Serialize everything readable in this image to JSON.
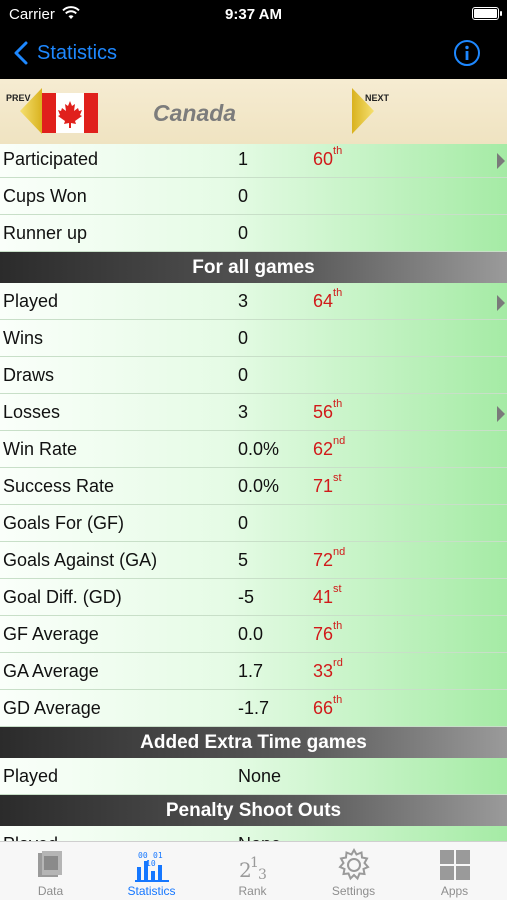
{
  "status_bar": {
    "carrier": "Carrier",
    "time": "9:37 AM"
  },
  "nav": {
    "back_label": "Statistics"
  },
  "team": {
    "name": "Canada",
    "prev_label": "PREV",
    "next_label": "NEXT"
  },
  "rows_top": [
    {
      "label": "Participated",
      "value": "1",
      "rank": "60",
      "suffix": "th",
      "chevron": true
    },
    {
      "label": "Cups Won",
      "value": "0",
      "rank": "",
      "suffix": "",
      "chevron": false
    },
    {
      "label": "Runner up",
      "value": "0",
      "rank": "",
      "suffix": "",
      "chevron": false
    }
  ],
  "section_all": {
    "title": "For all games"
  },
  "rows_all": [
    {
      "label": "Played",
      "value": "3",
      "rank": "64",
      "suffix": "th",
      "chevron": true
    },
    {
      "label": "Wins",
      "value": "0",
      "rank": "",
      "suffix": "",
      "chevron": false
    },
    {
      "label": "Draws",
      "value": "0",
      "rank": "",
      "suffix": "",
      "chevron": false
    },
    {
      "label": "Losses",
      "value": "3",
      "rank": "56",
      "suffix": "th",
      "chevron": true
    },
    {
      "label": "Win Rate",
      "value": "0.0%",
      "rank": "62",
      "suffix": "nd",
      "chevron": false
    },
    {
      "label": "Success Rate",
      "value": "0.0%",
      "rank": "71",
      "suffix": "st",
      "chevron": false
    },
    {
      "label": "Goals For (GF)",
      "value": "0",
      "rank": "",
      "suffix": "",
      "chevron": false
    },
    {
      "label": "Goals Against (GA)",
      "value": "5",
      "rank": "72",
      "suffix": "nd",
      "chevron": false
    },
    {
      "label": "Goal Diff. (GD)",
      "value": "-5",
      "rank": "41",
      "suffix": "st",
      "chevron": false
    },
    {
      "label": "GF Average",
      "value": "0.0",
      "rank": "76",
      "suffix": "th",
      "chevron": false
    },
    {
      "label": "GA Average",
      "value": "1.7",
      "rank": "33",
      "suffix": "rd",
      "chevron": false
    },
    {
      "label": "GD Average",
      "value": "-1.7",
      "rank": "66",
      "suffix": "th",
      "chevron": false
    }
  ],
  "section_extra": {
    "title": "Added Extra Time games"
  },
  "rows_extra": [
    {
      "label": "Played",
      "value": "None",
      "rank": "",
      "suffix": "",
      "chevron": false
    }
  ],
  "section_penalty": {
    "title": "Penalty Shoot Outs"
  },
  "rows_penalty": [
    {
      "label": "Played",
      "value": "None",
      "rank": "",
      "suffix": "",
      "chevron": false
    }
  ],
  "tabs": [
    {
      "label": "Data",
      "icon": "data-icon",
      "active": false
    },
    {
      "label": "Statistics",
      "icon": "statistics-icon",
      "active": true
    },
    {
      "label": "Rank",
      "icon": "rank-icon",
      "active": false
    },
    {
      "label": "Settings",
      "icon": "gear-icon",
      "active": false
    },
    {
      "label": "Apps",
      "icon": "apps-icon",
      "active": false
    }
  ],
  "colors": {
    "accent": "#1577ff",
    "rank_red": "#d11a1a",
    "row_green": "#a5eba5",
    "header_bg": "#f6ecd2"
  }
}
